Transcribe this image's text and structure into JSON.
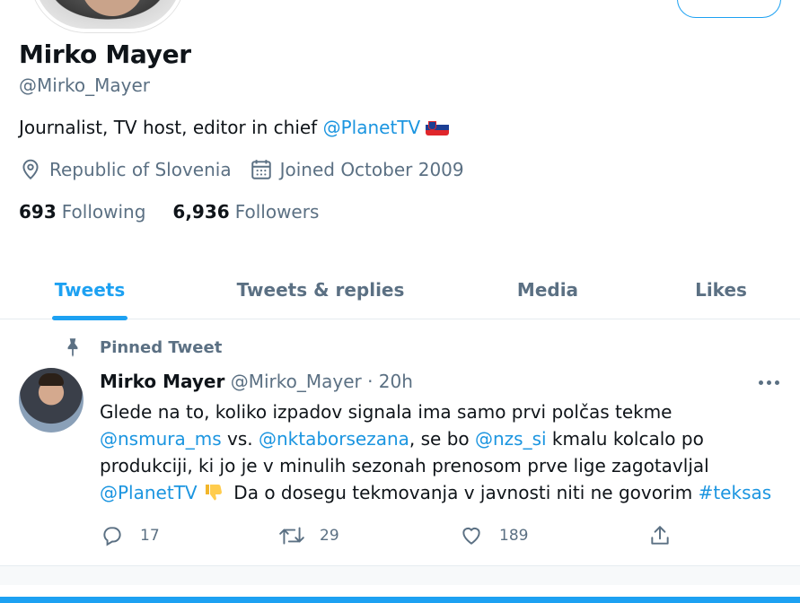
{
  "profile": {
    "name": "Mirko Mayer",
    "handle": "@Mirko_Mayer",
    "bio_text": "Journalist, TV host, editor in chief ",
    "bio_link": "@PlanetTV",
    "bio_flag": "flag-slovenia-icon",
    "location": "Republic of Slovenia",
    "joined": "Joined October 2009",
    "following_count": "693",
    "following_label": "Following",
    "followers_count": "6,936",
    "followers_label": "Followers"
  },
  "tabs": [
    {
      "label": "Tweets",
      "active": true
    },
    {
      "label": "Tweets & replies",
      "active": false
    },
    {
      "label": "Media",
      "active": false
    },
    {
      "label": "Likes",
      "active": false
    }
  ],
  "tweet": {
    "pinned_label": "Pinned Tweet",
    "author_name": "Mirko Mayer",
    "author_handle": "@Mirko_Mayer",
    "separator": " · ",
    "time": "20h",
    "text_1": "Glede na to, koliko izpadov signala ima samo prvi polčas tekme ",
    "mention_1": "@nsmura_ms",
    "text_2": " vs. ",
    "mention_2": "@nktaborsezana",
    "text_3": ", se bo ",
    "mention_3": "@nzs_si",
    "text_4": " kmalu kolcalo po produkciji, ki jo je v minulih sezonah prenosom prve lige zagotavljal ",
    "mention_4": "@PlanetTV",
    "emoji": "thumbs-down-icon",
    "text_5": " Da o dosegu tekmovanja v javnosti niti ne govorim ",
    "hashtag": "#teksas",
    "reply_count": "17",
    "retweet_count": "29",
    "like_count": "189"
  },
  "colors": {
    "accent": "#1da1f2",
    "link": "#1b95e0",
    "secondary_text": "#5b7083",
    "primary_text": "#0f1419"
  }
}
